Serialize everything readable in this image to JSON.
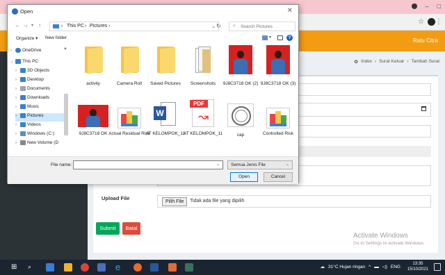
{
  "dialog": {
    "title": "Open",
    "path": [
      "This PC",
      "Pictures"
    ],
    "search_placeholder": "Search Pictures",
    "toolbar": {
      "organize": "Organize ▾",
      "new_folder": "New folder"
    },
    "nav": [
      {
        "label": "OneDrive",
        "color": "#2b7cd3"
      },
      {
        "label": "This PC",
        "color": "#3a80d2"
      },
      {
        "label": "3D Objects",
        "color": "#3a80d2"
      },
      {
        "label": "Desktop",
        "color": "#3a80d2"
      },
      {
        "label": "Documents",
        "color": "#9aa6b2"
      },
      {
        "label": "Downloads",
        "color": "#3a80d2"
      },
      {
        "label": "Music",
        "color": "#3a80d2"
      },
      {
        "label": "Pictures",
        "color": "#3a80d2"
      },
      {
        "label": "Videos",
        "color": "#3a80d2"
      },
      {
        "label": "Windows (C:)",
        "color": "#5c8fbf"
      },
      {
        "label": "New Volume (D",
        "color": "#888888"
      }
    ],
    "files": [
      {
        "label": "activity",
        "kind": "folder"
      },
      {
        "label": "Camera Roll",
        "kind": "folder"
      },
      {
        "label": "Saved Pictures",
        "kind": "folder"
      },
      {
        "label": "Screenshots",
        "kind": "screens"
      },
      {
        "label": "9J8C3718 OK (2)",
        "kind": "photo"
      },
      {
        "label": "9J8C3718 OK (3)",
        "kind": "photo"
      },
      {
        "label": "9J8C3718 OK",
        "kind": "photo-wide"
      },
      {
        "label": "Actual Residual Risk",
        "kind": "xls"
      },
      {
        "label": "AT KELOMPOK_11",
        "kind": "word"
      },
      {
        "label": "AT KELOMPOK_11",
        "kind": "pdf"
      },
      {
        "label": "cap",
        "kind": "cap"
      },
      {
        "label": "Controlled Risk",
        "kind": "xls"
      }
    ],
    "file_name_label": "File name:",
    "file_name_value": "",
    "file_type": "Semua Jenis File",
    "open_label": "Open",
    "cancel_label": "Cancel",
    "pdf_tag": "PDF",
    "word_glyph": "W"
  },
  "app": {
    "user_name": "Ratu Citra",
    "breadcrumb": [
      "Index",
      "Surat Keluar",
      "Tambah Surat"
    ],
    "upload_label": "Upload File",
    "choose_file_label": "Pilih File",
    "no_file_text": "Tidak ada file yang dipilih",
    "submit_label": "Submit",
    "cancel_label": "Batal",
    "watermark_title": "Activate Windows",
    "watermark_sub": "Go to Settings to activate Windows."
  },
  "taskbar": {
    "weather": "31°C Hujan ringan",
    "lang": "ENG",
    "time": "13:35",
    "date": "15/10/2021"
  },
  "colors": {
    "accent_orange": "#f39c12",
    "submit_green": "#00a65a",
    "cancel_red": "#dd4b39",
    "sidebar_dark": "#2b3337"
  }
}
